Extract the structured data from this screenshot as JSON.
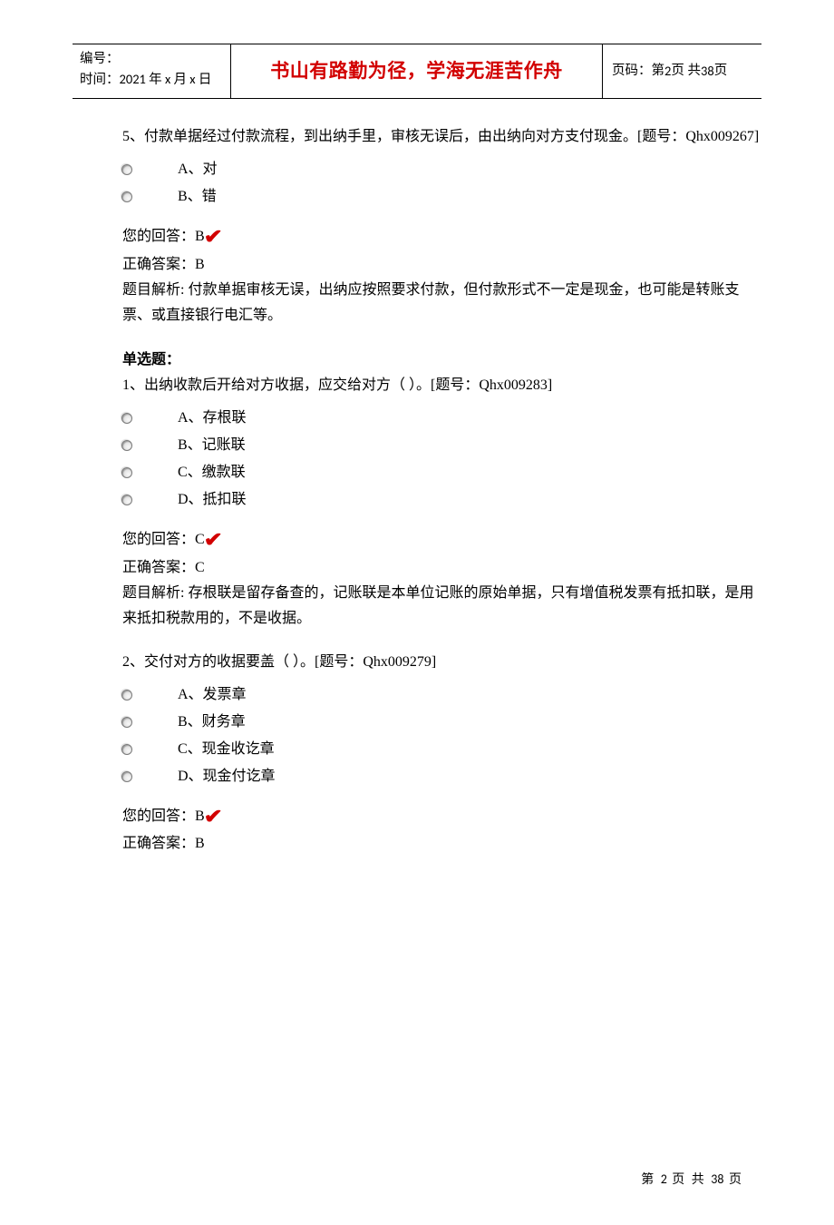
{
  "header": {
    "serial_label": "编号：",
    "time_label": "时间：",
    "time_value": "2021 年 x 月 x 日",
    "motto": "书山有路勤为径，学海无涯苦作舟",
    "page_label_prefix": "页码：第 ",
    "page_label_mid": " 页 共 ",
    "page_label_suffix": " 页",
    "page_current": "2",
    "page_total": "38"
  },
  "q5": {
    "text": "5、付款单据经过付款流程，到出纳手里，审核无误后，由出纳向对方支付现金。[题号：Qhx009267]",
    "optA": "A、对",
    "optB": "B、错",
    "your_label": "您的回答：",
    "your_value": "B",
    "correct_label": "正确答案：",
    "correct_value": "B",
    "explain_label": "题目解析: ",
    "explain": "付款单据审核无误，出纳应按照要求付款，但付款形式不一定是现金，也可能是转账支票、或直接银行电汇等。"
  },
  "single_choice_heading": "单选题：",
  "q1": {
    "text": "1、出纳收款后开给对方收据，应交给对方（ ）。[题号：Qhx009283]",
    "optA": "A、存根联",
    "optB": "B、记账联",
    "optC": "C、缴款联",
    "optD": "D、抵扣联",
    "your_label": "您的回答：",
    "your_value": "C",
    "correct_label": "正确答案：",
    "correct_value": "C",
    "explain_label": "题目解析: ",
    "explain": "存根联是留存备查的，记账联是本单位记账的原始单据，只有增值税发票有抵扣联，是用来抵扣税款用的，不是收据。"
  },
  "q2": {
    "text": "2、交付对方的收据要盖（ ）。[题号：Qhx009279]",
    "optA": "A、发票章",
    "optB": "B、财务章",
    "optC": "C、现金收讫章",
    "optD": "D、现金付讫章",
    "your_label": "您的回答：",
    "your_value": "B",
    "correct_label": "正确答案：",
    "correct_value": "B"
  },
  "footer": {
    "prefix": "第 ",
    "mid": " 页 共 ",
    "suffix": " 页",
    "current": "2",
    "total": "38"
  }
}
